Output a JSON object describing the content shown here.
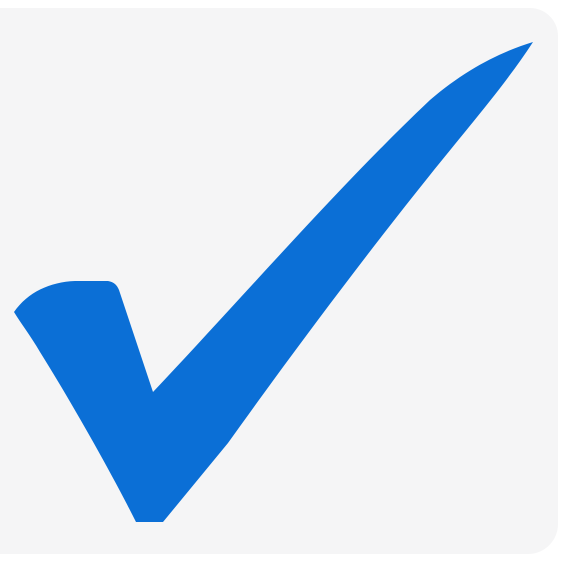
{
  "icon": {
    "name": "checkmark-icon",
    "check_color": "#0b6fd6",
    "tile_color": "#f5f5f6",
    "page_color": "#ffffff"
  }
}
